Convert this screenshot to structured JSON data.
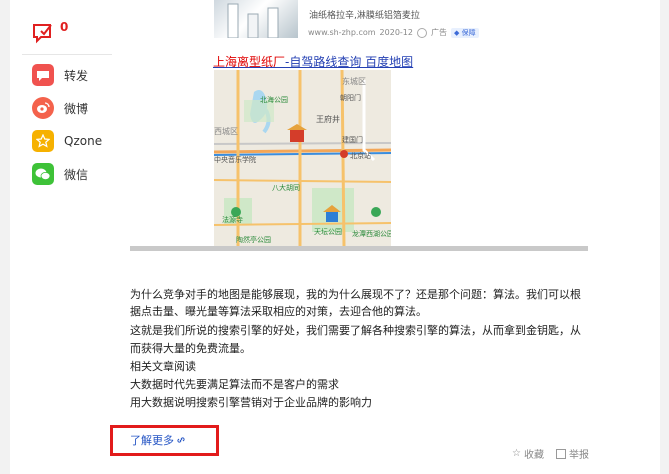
{
  "sidebar": {
    "comment_count": "0",
    "share_items": [
      {
        "label": "转发",
        "icon": "forward-icon",
        "color": "#f0524f"
      },
      {
        "label": "微博",
        "icon": "weibo-icon",
        "color": "#f4624c"
      },
      {
        "label": "Qzone",
        "icon": "qzone-icon",
        "color": "#f6b100"
      },
      {
        "label": "微信",
        "icon": "wechat-icon",
        "color": "#3ec238"
      }
    ]
  },
  "ad": {
    "description": "油纸格拉辛,淋膜纸铝箔麦拉",
    "domain": "www.sh-zhp.com",
    "date": "2020-12",
    "ad_label": "广告",
    "badge": "保障",
    "link_highlight": "上海离型纸厂",
    "link_rest": "-自驾路线查询 百度地图"
  },
  "map": {
    "labels": [
      "东城区",
      "北海公园",
      "王府井",
      "朝阳门",
      "西城区",
      "建国门",
      "中央音乐学院",
      "北京站",
      "八大胡同",
      "陶然亭公园",
      "天坛公园",
      "法源寺",
      "龙潭西湖公园"
    ]
  },
  "article": {
    "lines": [
      "为什么竞争对手的地图是能够展现，我的为什么展现不了？还是那个问题：算法。我们可以根",
      "据点击量、曝光量等算法采取相应的对策，去迎合他的算法。",
      "这就是我们所说的搜索引擎的好处，我们需要了解各种搜索引擎的算法，从而拿到金钥匙，从",
      "而获得大量的免费流量。",
      "相关文章阅读",
      "大数据时代先要满足算法而不是客户的需求",
      "用大数据说明搜索引擎营销对于企业品牌的影响力"
    ],
    "learn_more": "了解更多"
  },
  "footer": {
    "favorite": "收藏",
    "report": "举报"
  },
  "colors": {
    "link": "#2440b3",
    "highlight_red": "#e21b1b"
  }
}
